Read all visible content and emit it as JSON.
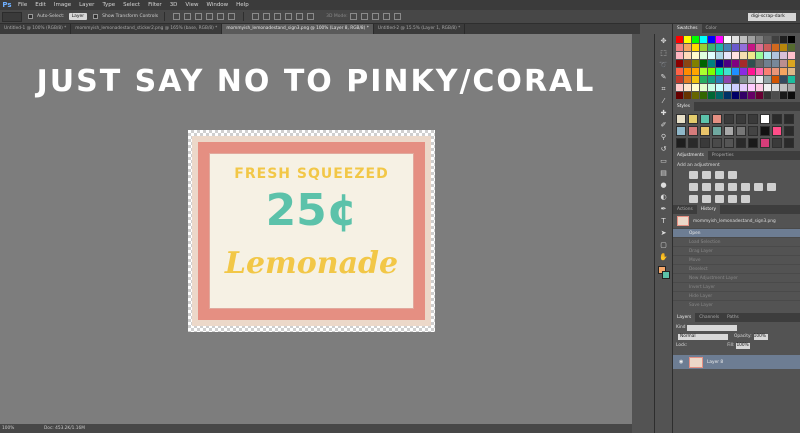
{
  "app": {
    "logo": "Ps",
    "menu": [
      "File",
      "Edit",
      "Image",
      "Layer",
      "Type",
      "Select",
      "Filter",
      "3D",
      "View",
      "Window",
      "Help"
    ]
  },
  "options": {
    "auto_select": "Auto-Select:",
    "layer_select": "Layer",
    "transform": "Show Transform Controls",
    "mode_3d": "3D Mode:",
    "workspace": "digi-scrap-dark"
  },
  "tabs": [
    "Untitled-1 @ 100% (RGB/8) *",
    "mommyish_lemonadestand_sticker2.png @ 165% (base, RGB/8) *",
    "mommyish_lemonadestand_sign3.png @ 100% (Layer 8, RGB/8) *",
    "Untitled-2 @ 15.5% (Layer 1, RGB/8) *"
  ],
  "canvas": {
    "headline": "JUST SAY NO TO PINKY/CORAL",
    "card_line1": "FRESH SQUEEZED",
    "card_price": "25¢",
    "card_name": "Lemonade"
  },
  "status": {
    "zoom": "100%",
    "doc": "Doc: 453.2K/1.16M"
  },
  "panels": {
    "swatches_tab": "Swatches",
    "color_tab": "Color",
    "styles_tab": "Styles",
    "adjustments_tab": "Adjustments",
    "properties_tab": "Properties",
    "adjustments_title": "Add an adjustment",
    "actions_tab": "Actions",
    "history_tab": "History",
    "history_file": "mommyish_lemonadestand_sign3.png",
    "history_items": [
      "Open",
      "Load Selection",
      "Drag Layer",
      "Move",
      "Deselect",
      "New Adjustment Layer",
      "Invert Layer",
      "Hide Layer",
      "Save Layer"
    ],
    "layers_tab": "Layers",
    "channels_tab": "Channels",
    "paths_tab": "Paths",
    "kind": "Kind",
    "blend": "Normal",
    "opacity_label": "Opacity:",
    "opacity": "100%",
    "lock_label": "Lock:",
    "fill_label": "Fill:",
    "fill": "100%",
    "layer_name": "Layer 8"
  },
  "colors": {
    "swatches": [
      "#ff0000",
      "#ffff00",
      "#00ff00",
      "#00ffff",
      "#0000ff",
      "#ff00ff",
      "#ffffff",
      "#e0e0e0",
      "#c0c0c0",
      "#a0a0a0",
      "#808080",
      "#606060",
      "#404040",
      "#202020",
      "#000000",
      "#f08080",
      "#f4a460",
      "#ffd700",
      "#9acd32",
      "#3cb371",
      "#20b2aa",
      "#4682b4",
      "#6a5acd",
      "#9370db",
      "#c71585",
      "#db7093",
      "#cd5c5c",
      "#d2691e",
      "#b8860b",
      "#556b2f",
      "#ffb6c1",
      "#ffdab9",
      "#fffacd",
      "#e0ffe0",
      "#e0ffff",
      "#add8e6",
      "#e6e6fa",
      "#ffe4e1",
      "#f5deb3",
      "#f0e68c",
      "#98fb98",
      "#afeeee",
      "#b0c4de",
      "#d8bfd8",
      "#ffc0cb",
      "#8b0000",
      "#8b4513",
      "#808000",
      "#006400",
      "#008080",
      "#000080",
      "#4b0082",
      "#800080",
      "#a52a2a",
      "#2f4f4f",
      "#696969",
      "#708090",
      "#778899",
      "#bc8f8f",
      "#daa520",
      "#ff6347",
      "#ff8c00",
      "#ffa500",
      "#adff2f",
      "#7fff00",
      "#00fa9a",
      "#40e0d0",
      "#1e90ff",
      "#8a2be2",
      "#ff1493",
      "#ff69b4",
      "#fa8072",
      "#e9967a",
      "#f4a460",
      "#deb887",
      "#c0392b",
      "#e67e22",
      "#f1c40f",
      "#27ae60",
      "#16a085",
      "#2980b9",
      "#8e44ad",
      "#2c3e50",
      "#7f8c8d",
      "#bdc3c7",
      "#ecf0f1",
      "#95a5a6",
      "#d35400",
      "#34495e",
      "#1abc9c",
      "#ffcccc",
      "#ffe5cc",
      "#ffffcc",
      "#e5ffcc",
      "#ccffe5",
      "#ccffff",
      "#cce5ff",
      "#ccccff",
      "#e5ccff",
      "#ffccff",
      "#ffcce5",
      "#f2f2f2",
      "#d9d9d9",
      "#bfbfbf",
      "#a6a6a6",
      "#660000",
      "#663300",
      "#666600",
      "#336600",
      "#006633",
      "#006666",
      "#003366",
      "#000066",
      "#330066",
      "#660066",
      "#660033",
      "#333333",
      "#4d4d4d",
      "#1a1a1a",
      "#0d0d0d"
    ],
    "styles": [
      "#e8e0c8",
      "#e4cc6c",
      "#5cc2aa",
      "#e58f82",
      "#3a3a3a",
      "#3a3a3a",
      "#3a3a3a",
      "#ffffff",
      "#2a2a2a",
      "#2a2a2a",
      "#8fb7c9",
      "#d67b7b",
      "#e9c46a",
      "#6fa8a0",
      "#a9a9a9",
      "#777777",
      "#444444",
      "#111111",
      "#ff4d88",
      "#2a2a2a",
      "#1e1e1e",
      "#2a2a2a",
      "#3a3a3a",
      "#4a4a4a",
      "#555555",
      "#2a2a2a",
      "#1a1a1a",
      "#d63d7a",
      "#3a3a3a",
      "#2a2a2a"
    ]
  }
}
